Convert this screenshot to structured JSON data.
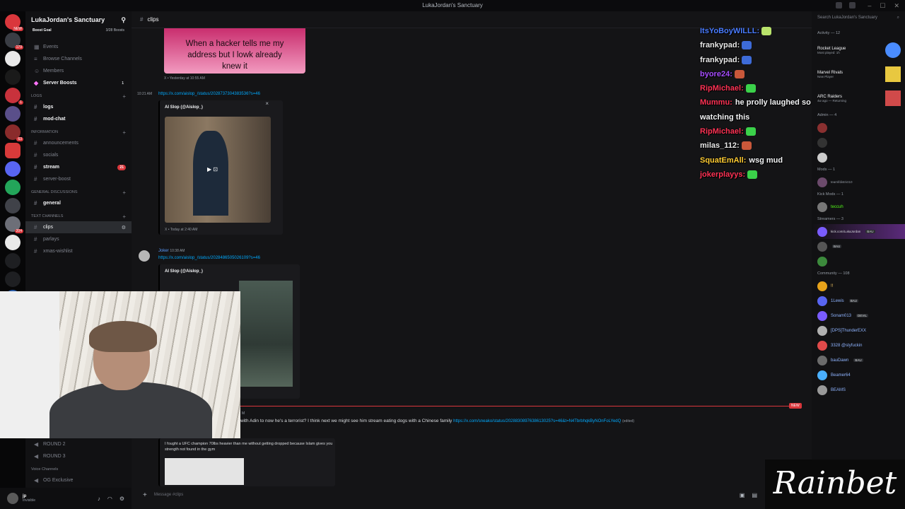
{
  "window": {
    "title": "LukaJordan's Sanctuary",
    "controls": [
      "–",
      "☐",
      "✕"
    ]
  },
  "guild": {
    "name": "LukaJordan's Sanctuary",
    "boost_goal": "Boost Goal",
    "boost_count": "3/28 Boosts",
    "top_items": [
      {
        "label": "Events"
      },
      {
        "label": "Browse Channels"
      },
      {
        "label": "Members"
      },
      {
        "label": "Server Boosts",
        "count": "1"
      }
    ],
    "categories": [
      {
        "name": "LOGS",
        "channels": [
          {
            "label": "logs",
            "bright": true
          },
          {
            "label": "mod-chat",
            "bright": true
          }
        ]
      },
      {
        "name": "INFORMATION",
        "channels": [
          {
            "label": "announcements"
          },
          {
            "label": "socials"
          },
          {
            "label": "stream",
            "bright": true,
            "count": "21"
          },
          {
            "label": "server-boost"
          }
        ]
      },
      {
        "name": "GENERAL DISCUSSIONS",
        "channels": [
          {
            "label": "general",
            "bright": true
          }
        ]
      },
      {
        "name": "TEXT CHANNELS",
        "channels": [
          {
            "label": "clips",
            "selected": true
          },
          {
            "label": "parlays"
          },
          {
            "label": "xmas-wishlist"
          }
        ]
      }
    ],
    "voice": {
      "rounds": [
        "ROUND 2",
        "ROUND 3"
      ],
      "voice_category": "Voice Channels",
      "voice_channel": "OG Exclusive"
    }
  },
  "server_badges": [
    "NEW",
    "179",
    "1",
    "63",
    "204",
    "NEW"
  ],
  "user": {
    "name": "jp",
    "status": "Invisible"
  },
  "channel": {
    "name": "clips",
    "composer_placeholder": "Message #clips"
  },
  "messages": {
    "meme_caption": "When a hacker tells me my address but I lowk already knew it",
    "meme_footer": "X • Yesterday at 10:55 AM",
    "m1_time": "10:21 AM",
    "m1_link": "https://x.com/aislop_/status/2028737304383536?s=46",
    "m1_embed_author": "AI Slop (@Aislop_)",
    "m1_footer": "X • Today at 2:40 AM",
    "m2_author": "Joker",
    "m2_time": "10:38 AM",
    "m2_link": "https://x.com/aislop_/status/2028486505026109?s=46",
    "m2_embed_author": "AI Slop (@Aislop_)",
    "m3_time": "M",
    "m3_text": "with Adin to now he's a terrorist? I think next we might see him stream eating dogs with a Chinese family",
    "m3_link": "https://x.com/sneako/status/2028830897638613025?s=46&t=N4TbrbhqkByNOnFoLYedQ",
    "m3_edited": "(edited)",
    "m3_embed_text": "I fought a UFC champion 70lbs heavier than me without getting dropped because Islam gives you strength not found in the gym",
    "new_label": "NEW"
  },
  "stream_chat": [
    {
      "user": "ItsYoBoyWILLL:",
      "color": "#4a7cff",
      "text": "",
      "emote": "#b9e36b"
    },
    {
      "user": "frankypad:",
      "color": "#e9e9e9",
      "text": "",
      "emote": "#3d6bd8"
    },
    {
      "user": "frankypad:",
      "color": "#e9e9e9",
      "text": "",
      "emote": "#3d6bd8"
    },
    {
      "user": "byore24:",
      "color": "#a64dff",
      "text": "",
      "emote": "#c9583a"
    },
    {
      "user": "RipMichael:",
      "color": "#ff3355",
      "text": "",
      "emote": "#3bd14a"
    },
    {
      "user": "Mummu:",
      "color": "#ff3355",
      "text": "he prolly laughed so hard",
      "emote": ""
    },
    {
      "user": "",
      "color": "#e9e9e9",
      "text": "watching this",
      "emote": ""
    },
    {
      "user": "RipMichael:",
      "color": "#ff3355",
      "text": "",
      "emote": "#3bd14a"
    },
    {
      "user": "milas_112:",
      "color": "#e9e9e9",
      "text": "",
      "emote": "#c9583a"
    },
    {
      "user": "SquatEmAll:",
      "color": "#ffcc33",
      "text": "wsg mud",
      "emote": ""
    },
    {
      "user": "jokerplayys:",
      "color": "#ff3355",
      "text": "",
      "emote": "#3bd14a"
    }
  ],
  "members_panel": {
    "search_placeholder": "Search LukaJordan's Sanctuary",
    "activity_header": "Activity — 12",
    "activities": [
      {
        "game": "Rocket League",
        "detail": "Most played: 1h",
        "color": "#4a8cff"
      },
      {
        "game": "Marvel Rivals",
        "detail": "New Player",
        "color": "#e8c840"
      },
      {
        "game": "ARC Raiders",
        "detail": "4w ago — Returning",
        "color": "#d04a4a"
      }
    ],
    "admin_header": "Admin — 4",
    "mods_header": "Mods — 1",
    "mods_sub": "teamf/district10",
    "kick_header": "Kick Mods — 1",
    "kick_member": "teccuh",
    "streamers_header": "Streamers — 3",
    "streamer_sub": "kick.com/LukaJordan",
    "streamer_tag": "BAU",
    "community_header": "Community — 108",
    "community": [
      {
        "name": "!!",
        "color": "#ffd166",
        "av": "#e6a21a",
        "tag": ""
      },
      {
        "name": "1Lewis",
        "color": "#8fb4ff",
        "av": "#5865f2",
        "tag": "BAU"
      },
      {
        "name": "Sonam013",
        "color": "#8fb4ff",
        "av": "#7a5cff",
        "tag": "DEVIL"
      },
      {
        "name": "[DPS]ThunderEXX",
        "color": "#8fb4ff",
        "av": "#b0b0b0",
        "tag": ""
      },
      {
        "name": "3328 @styfuckin",
        "color": "#8fb4ff",
        "av": "#e04a4a",
        "tag": ""
      },
      {
        "name": "bauDawn",
        "color": "#8fb4ff",
        "av": "#6b6b6b",
        "tag": "BAU"
      },
      {
        "name": "Beamer64",
        "color": "#8fb4ff",
        "av": "#4ab0ff",
        "tag": ""
      },
      {
        "name": "BEAMS",
        "color": "#8fb4ff",
        "av": "#999999",
        "tag": ""
      }
    ]
  },
  "sponsor": {
    "text": "Rainbet"
  },
  "colors": {
    "accent": "#5865f2",
    "danger": "#da373c",
    "link": "#00a8fc"
  }
}
